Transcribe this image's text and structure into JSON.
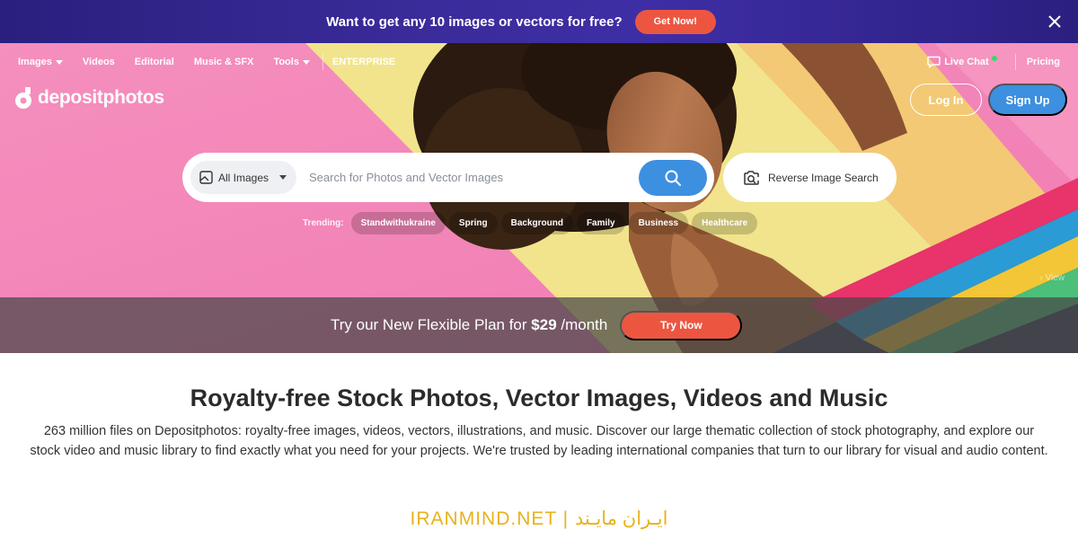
{
  "promo": {
    "text": "Want to get any 10 images or vectors for free?",
    "button": "Get Now!"
  },
  "nav": {
    "items": [
      "Images",
      "Videos",
      "Editorial",
      "Music & SFX",
      "Tools",
      "ENTERPRISE"
    ],
    "live_chat": "Live Chat",
    "pricing": "Pricing"
  },
  "brand": {
    "name": "depositphotos"
  },
  "auth": {
    "login": "Log In",
    "signup": "Sign Up"
  },
  "search": {
    "category": "All Images",
    "placeholder": "Search for Photos and Vector Images",
    "reverse_label": "Reverse Image Search"
  },
  "trending": {
    "label": "Trending:",
    "tags": [
      "Standwithukraine",
      "Spring",
      "Background",
      "Family",
      "Business",
      "Healthcare"
    ]
  },
  "hero": {
    "view_label": "View"
  },
  "offer": {
    "text_before": "Try our New Flexible Plan for ",
    "price": "$29",
    "text_after": " /month",
    "button": "Try Now"
  },
  "content": {
    "headline": "Royalty-free Stock Photos, Vector Images, Videos and Music",
    "description": "263 million files on Depositphotos: royalty-free images, videos, vectors, illustrations, and music. Discover our large thematic collection of stock photography, and explore our stock video and music library to find exactly what you need for your projects. We're trusted by leading international companies that turn to our library for visual and audio content."
  },
  "watermark": "IRANMIND.NET | ایـران مایـند",
  "colors": {
    "promo_bg": "#2f2490",
    "accent_red": "#ec5641",
    "accent_blue": "#3d8fe0",
    "hero_pink": "#f58fbd",
    "hero_yellow": "#f3e28a",
    "watermark": "#e8b21b"
  }
}
